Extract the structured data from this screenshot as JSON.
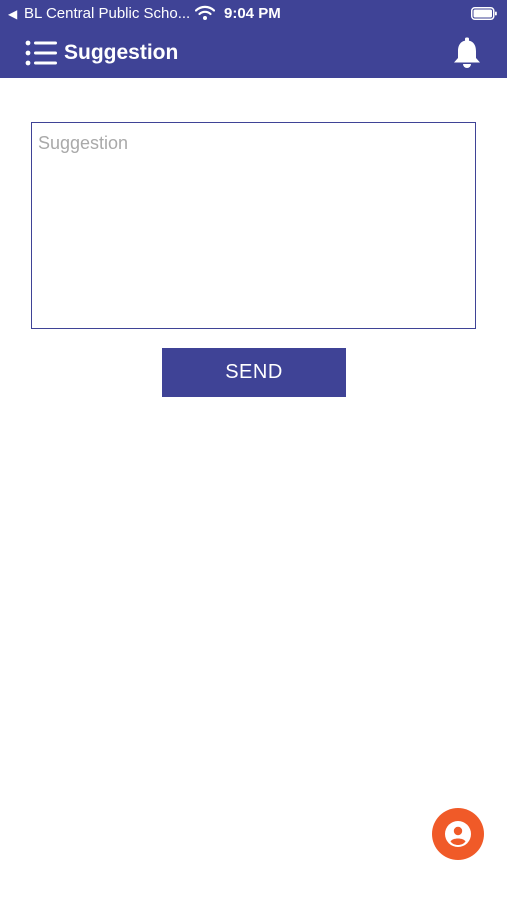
{
  "status_bar": {
    "back_arrow": "◀",
    "app_name": "BL Central Public Scho...",
    "time": "9:04 PM",
    "icons": [
      "wifi-icon",
      "battery-icon"
    ]
  },
  "app_bar": {
    "title": "Suggestion",
    "menu_icon": "menu-list-icon",
    "notification_icon": "bell-icon"
  },
  "form": {
    "suggestion_placeholder": "Suggestion",
    "suggestion_value": "",
    "send_label": "SEND"
  },
  "fab": {
    "icon": "user-profile-icon"
  },
  "colors": {
    "primary": "#3f4396",
    "accent": "#f05a28",
    "placeholder": "#a9a9a9",
    "background": "#ffffff"
  }
}
